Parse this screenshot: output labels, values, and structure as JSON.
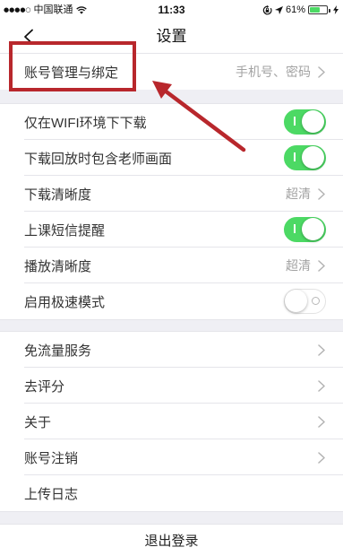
{
  "status_bar": {
    "signal": "●●●●○",
    "carrier": "中国联通",
    "wifi_icon": "wifi-icon",
    "time": "11:33",
    "orientation_icon": "orientation-lock-icon",
    "location_icon": "location-arrow-icon",
    "battery_text": "61%",
    "battery_level": 0.61,
    "charging_icon": "charging-bolt-icon"
  },
  "nav": {
    "back_icon": "chevron-left-icon",
    "title": "设置"
  },
  "account": {
    "label": "账号管理与绑定",
    "value": "手机号、密码",
    "icon": "chevron-right-icon"
  },
  "settings": [
    {
      "label": "仅在WIFI环境下下载",
      "on": true
    },
    {
      "label": "下载回放时包含老师画面",
      "on": true
    },
    {
      "label": "下载清晰度",
      "value": "超清"
    },
    {
      "label": "上课短信提醒",
      "on": true
    },
    {
      "label": "播放清晰度",
      "value": "超清"
    },
    {
      "label": "启用极速模式",
      "on": false
    }
  ],
  "services": [
    {
      "label": "免流量服务",
      "chevron": true
    },
    {
      "label": "去评分",
      "chevron": true
    },
    {
      "label": "关于",
      "chevron": true
    },
    {
      "label": "账号注销",
      "chevron": true
    },
    {
      "label": "上传日志",
      "chevron": false
    }
  ],
  "logout": {
    "label": "退出登录"
  },
  "colors": {
    "toggle_on": "#4cd964",
    "background": "#efeff4",
    "annotation": "#b8272c",
    "primary_text": "#333333",
    "secondary_text": "#a3a3a3",
    "separator": "#e5e5ea"
  }
}
